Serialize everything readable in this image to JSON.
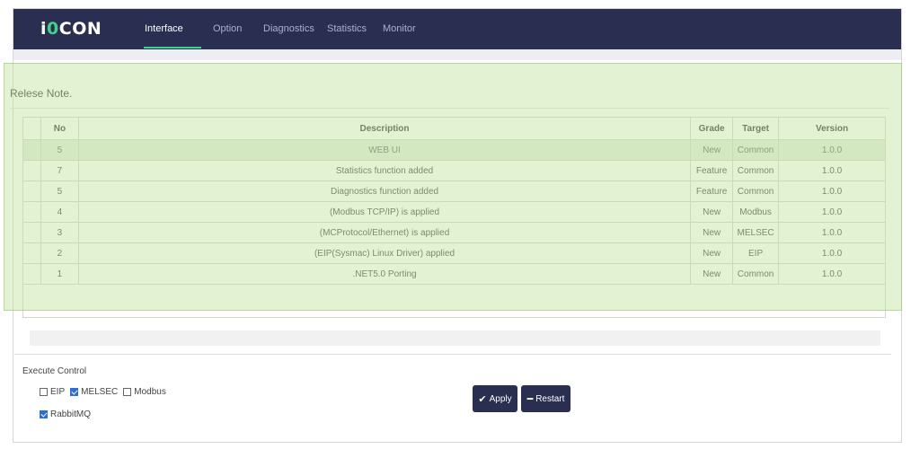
{
  "app": {
    "logo_prefix": "i",
    "logo_accent": "0",
    "logo_suffix": "CON"
  },
  "nav": {
    "tabs": [
      "Interface",
      "Option",
      "Diagnostics",
      "Statistics",
      "Monitor"
    ],
    "active": "Interface"
  },
  "release": {
    "title": "Relese Note.",
    "columns": [
      "No",
      "Description",
      "Grade",
      "Target",
      "Version"
    ],
    "rows": [
      {
        "no": "5",
        "description": "WEB UI",
        "grade": "New",
        "target": "Common",
        "version": "1.0.0"
      },
      {
        "no": "7",
        "description": "Statistics function added",
        "grade": "Feature",
        "target": "Common",
        "version": "1.0.0"
      },
      {
        "no": "5",
        "description": "Diagnostics function added",
        "grade": "Feature",
        "target": "Common",
        "version": "1.0.0"
      },
      {
        "no": "4",
        "description": "(Modbus TCP/IP) is applied",
        "grade": "New",
        "target": "Modbus",
        "version": "1.0.0"
      },
      {
        "no": "3",
        "description": "(MCProtocol/Ethernet) is applied",
        "grade": "New",
        "target": "MELSEC",
        "version": "1.0.0"
      },
      {
        "no": "2",
        "description": "(EIP(Sysmac) Linux Driver) applied",
        "grade": "New",
        "target": "EIP",
        "version": "1.0.0"
      },
      {
        "no": "1",
        "description": ".NET5.0 Porting",
        "grade": "New",
        "target": "Common",
        "version": "1.0.0"
      }
    ]
  },
  "execute": {
    "title": "Execute Control",
    "options": [
      {
        "label": "EIP",
        "checked": false
      },
      {
        "label": "MELSEC",
        "checked": true
      },
      {
        "label": "Modbus",
        "checked": false
      },
      {
        "label": "RabbitMQ",
        "checked": true
      }
    ]
  },
  "buttons": {
    "apply_label": "Apply",
    "apply_icon": "checkmark-icon",
    "restart_label": "Restart",
    "restart_icon": "minus-icon"
  },
  "colors": {
    "navbar": "#2a2f52",
    "accent": "#3fd28f",
    "overlay": "#c4e2a0",
    "checkbox": "#2e6fd3"
  }
}
